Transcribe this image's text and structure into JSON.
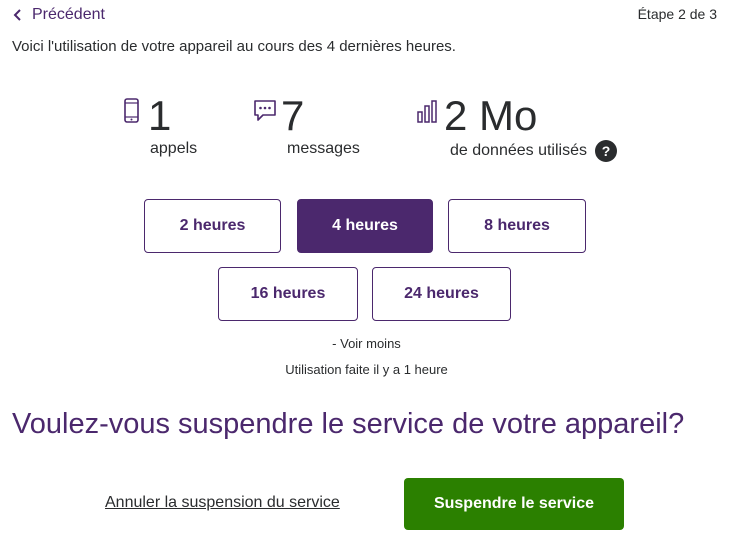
{
  "header": {
    "back_label": "Précédent",
    "step_label": "Étape 2 de 3"
  },
  "intro": "Voici l'utilisation de votre appareil au cours des 4 dernières heures.",
  "stats": {
    "calls": {
      "value": "1",
      "label": "appels",
      "icon": "phone-icon"
    },
    "messages": {
      "value": "7",
      "label": "messages",
      "icon": "chat-bubble-icon"
    },
    "data": {
      "value": "2 Mo",
      "label": "de données utilisés",
      "icon": "bar-chart-icon",
      "help": "?"
    }
  },
  "time_ranges": {
    "selected": "4 heures",
    "options": [
      "2 heures",
      "4 heures",
      "8 heures",
      "16 heures",
      "24 heures"
    ]
  },
  "see_less": "- Voir moins",
  "usage_time": "Utilisation faite il y a 1 heure",
  "question": "Voulez-vous suspendre le service de votre appareil?",
  "actions": {
    "cancel_label": "Annuler la suspension du service",
    "suspend_label": "Suspendre le service"
  },
  "colors": {
    "brand_purple": "#4b286d",
    "action_green": "#2b8000",
    "text": "#2a2c2e"
  }
}
